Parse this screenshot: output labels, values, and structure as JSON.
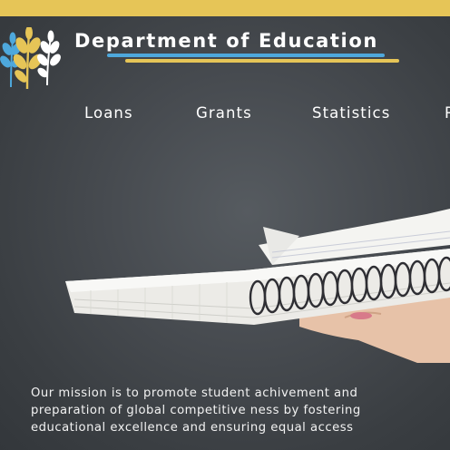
{
  "header": {
    "title": "Department of Education",
    "logo_icon": "wheat-stalks-logo-icon",
    "accent_blue": "#4ea8dc",
    "accent_yellow": "#e6c557"
  },
  "nav": {
    "items": [
      {
        "label": "Loans"
      },
      {
        "label": "Grants"
      },
      {
        "label": "Statistics"
      },
      {
        "label": "R"
      }
    ]
  },
  "hero": {
    "image_icon": "notebooks-in-hand-image"
  },
  "mission": {
    "lines": [
      "Our mission is to promote student achivement and",
      "preparation of global competitive ness by fostering",
      "educational excellence and ensuring equal access"
    ]
  }
}
